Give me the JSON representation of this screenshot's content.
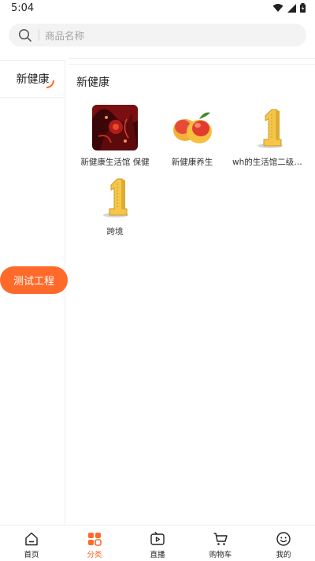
{
  "status": {
    "time": "5:04"
  },
  "search": {
    "placeholder": "商品名称"
  },
  "sidebar": {
    "active_category": "新健康",
    "floating_button": "测试工程"
  },
  "main": {
    "section_title": "新健康",
    "items": [
      {
        "label": "新健康生活馆 保健",
        "image": "dark-red-abstract-image"
      },
      {
        "label": "新健康养生",
        "image": "peaches-image"
      },
      {
        "label": "wh的生活馆二级类目",
        "image": "gold-number-one-image"
      },
      {
        "label": "跨境",
        "image": "gold-number-one-image"
      }
    ]
  },
  "bottom_nav": {
    "items": [
      {
        "label": "首页",
        "icon": "home-icon"
      },
      {
        "label": "分类",
        "icon": "category-icon"
      },
      {
        "label": "直播",
        "icon": "live-icon"
      },
      {
        "label": "购物车",
        "icon": "cart-icon"
      },
      {
        "label": "我的",
        "icon": "profile-icon"
      }
    ],
    "active_index": 1
  },
  "colors": {
    "accent": "#ff6a2a",
    "search_bg": "#f3f3f3",
    "divider": "#efefef"
  }
}
